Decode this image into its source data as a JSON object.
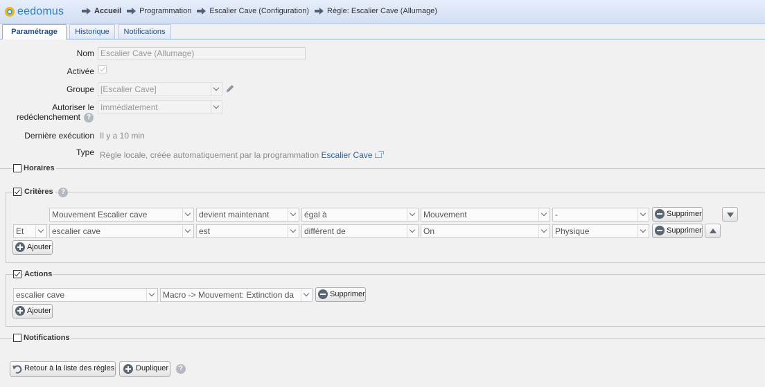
{
  "app": {
    "logo_text": "eedomus"
  },
  "breadcrumb": [
    {
      "label": "Accueil",
      "bold": true
    },
    {
      "label": "Programmation"
    },
    {
      "label": "Escalier Cave (Configuration)"
    },
    {
      "label": "Règle: Escalier Cave (Allumage)"
    }
  ],
  "tabs": [
    {
      "label": "Paramétrage",
      "active": true
    },
    {
      "label": "Historique"
    },
    {
      "label": "Notifications"
    }
  ],
  "form": {
    "nom_label": "Nom",
    "nom_value": "Escalier Cave (Allumage)",
    "activee_label": "Activée",
    "activee_checked": true,
    "groupe_label": "Groupe",
    "groupe_value": "[Escalier Cave]",
    "autoriser_label_1": "Autoriser le",
    "autoriser_label_2": "redéclenchement",
    "autoriser_value": "Immédiatement",
    "derniere_label": "Dernière exécution",
    "derniere_value": "Il y a 10 min",
    "type_label": "Type",
    "type_value": "Règle locale, créée automatiquement par la programmation",
    "type_link": "Escalier Cave"
  },
  "sections": {
    "horaires": {
      "title": "Horaires",
      "checked": false
    },
    "criteres": {
      "title": "Critères",
      "checked": true
    },
    "actions": {
      "title": "Actions",
      "checked": true
    },
    "notifications": {
      "title": "Notifications",
      "checked": false
    }
  },
  "criteria_rows": [
    {
      "connector": "",
      "device": "Mouvement Escalier cave",
      "condition": "devient maintenant",
      "operator": "égal à",
      "value": "Mouvement",
      "extra": "-",
      "remove_label": "Supprimer",
      "move": "down"
    },
    {
      "connector": "Et",
      "device": "escalier cave",
      "condition": "est",
      "operator": "différent de",
      "value": "On",
      "extra": "Physique",
      "remove_label": "Supprimer",
      "move": "up"
    }
  ],
  "add_label": "Ajouter",
  "actions_rows": [
    {
      "device": "escalier cave",
      "action": "Macro -> Mouvement: Extinction da",
      "remove_label": "Supprimer"
    }
  ],
  "footer": {
    "back_label": "Retour à la liste des règles",
    "duplicate_label": "Dupliquer"
  },
  "colors": {
    "accent": "#2d5f95",
    "header_bg": "#d2def2",
    "page_bg": "#f1f1f1"
  }
}
